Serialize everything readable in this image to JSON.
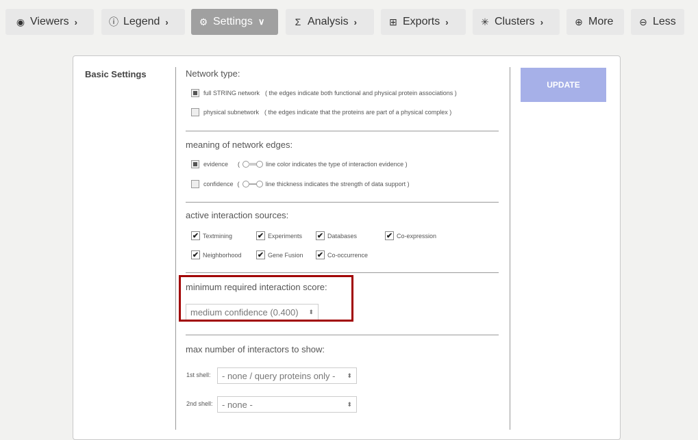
{
  "toolbar": {
    "viewers": "Viewers",
    "legend": "Legend",
    "settings": "Settings",
    "analysis": "Analysis",
    "exports": "Exports",
    "clusters": "Clusters",
    "more": "More",
    "less": "Less"
  },
  "panel": {
    "title": "Basic Settings",
    "update_label": "UPDATE",
    "network_type": {
      "heading": "Network type:",
      "options": [
        {
          "label": "full STRING network",
          "note": "( the edges indicate both functional and physical protein associations )",
          "selected": true
        },
        {
          "label": "physical subnetwork",
          "note": "( the edges indicate that the proteins are part of a physical complex )",
          "selected": false
        }
      ]
    },
    "edges": {
      "heading": "meaning of network edges:",
      "options": [
        {
          "label": "evidence",
          "note": "line color indicates the type of interaction evidence )",
          "selected": true
        },
        {
          "label": "confidence",
          "note": "line thickness indicates the strength of data support )",
          "selected": false
        }
      ]
    },
    "sources": {
      "heading": "active interaction sources:",
      "items": [
        "Textmining",
        "Experiments",
        "Databases",
        "Co-expression",
        "Neighborhood",
        "Gene Fusion",
        "Co-occurrence"
      ]
    },
    "score": {
      "heading": "minimum required interaction score:",
      "value": "medium confidence (0.400)"
    },
    "interactors": {
      "heading": "max number of interactors to show:",
      "shell1_label": "1st shell:",
      "shell1_value": "- none / query proteins only -",
      "shell2_label": "2nd shell:",
      "shell2_value": "- none -"
    }
  },
  "colors": {
    "highlight": "#a10000",
    "update_button": "#a6b0e8",
    "active_tab": "#a0a0a0"
  }
}
